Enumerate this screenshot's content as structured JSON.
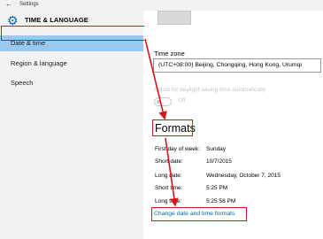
{
  "window": {
    "back_icon": "arrow-left-icon",
    "title": "Settings"
  },
  "sidebar": {
    "header_icon": "gear-icon",
    "header": "TIME & LANGUAGE",
    "items": [
      {
        "label": "Date & time",
        "selected": true
      },
      {
        "label": "Region & language",
        "selected": false
      },
      {
        "label": "Speech",
        "selected": false
      }
    ]
  },
  "main": {
    "time_zone": {
      "label": "Time zone",
      "value": "(UTC+08:00) Beijing, Chongqing, Hong Kong, Urumqi"
    },
    "dst": {
      "label": "Adjust for daylight saving time automatically",
      "state": "Off",
      "enabled": false
    },
    "formats": {
      "title": "Formats",
      "rows": [
        {
          "label": "First day of week:",
          "value": "Sunday"
        },
        {
          "label": "Short date:",
          "value": "10/7/2015"
        },
        {
          "label": "Long date:",
          "value": "Wednesday, October 7, 2015"
        },
        {
          "label": "Short time:",
          "value": "5:25 PM"
        },
        {
          "label": "Long time:",
          "value": "5:25:58 PM"
        }
      ],
      "link": "Change date and time formats"
    }
  },
  "colors": {
    "accent": "#0063b1",
    "selection": "#99c9ef",
    "annotation": "#d9141b"
  }
}
